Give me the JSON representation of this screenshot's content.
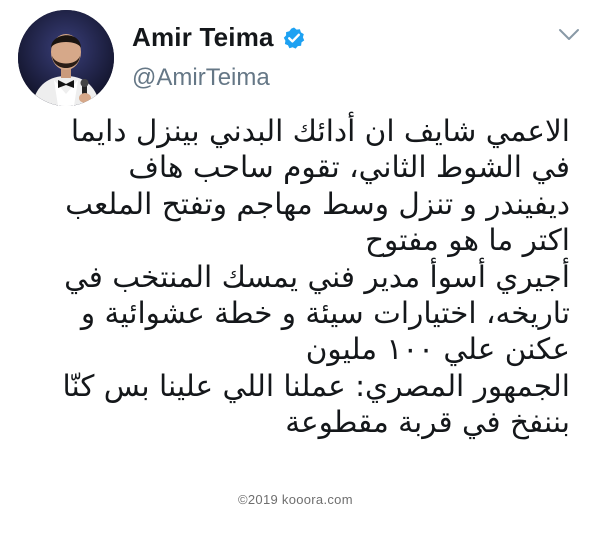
{
  "user": {
    "display_name": "Amir Teima",
    "handle": "@AmirTeima",
    "verified": true
  },
  "icons": {
    "verified": "verified-badge-icon",
    "menu": "chevron-down-icon"
  },
  "colors": {
    "verified_blue": "#1DA1F2",
    "handle_gray": "#657786",
    "text": "#14171a"
  },
  "tweet": {
    "lines": [
      "الاعمي شايف ان أدائك البدني بينزل دايما",
      "في الشوط الثاني، تقوم ساحب هاف",
      "ديفيندر و تنزل وسط مهاجم وتفتح الملعب",
      "اكتر ما هو مفتوح",
      "أجيري أسوأ مدير فني يمسك المنتخب في",
      "تاريخه، اختيارات سيئة و خطة عشوائية و",
      "عكنن علي ١٠٠ مليون",
      "الجمهور المصري: عملنا اللي علينا بس كنّا",
      "بننفخ في قربة مقطوعة"
    ]
  },
  "watermark": "©2019 kooora.com"
}
